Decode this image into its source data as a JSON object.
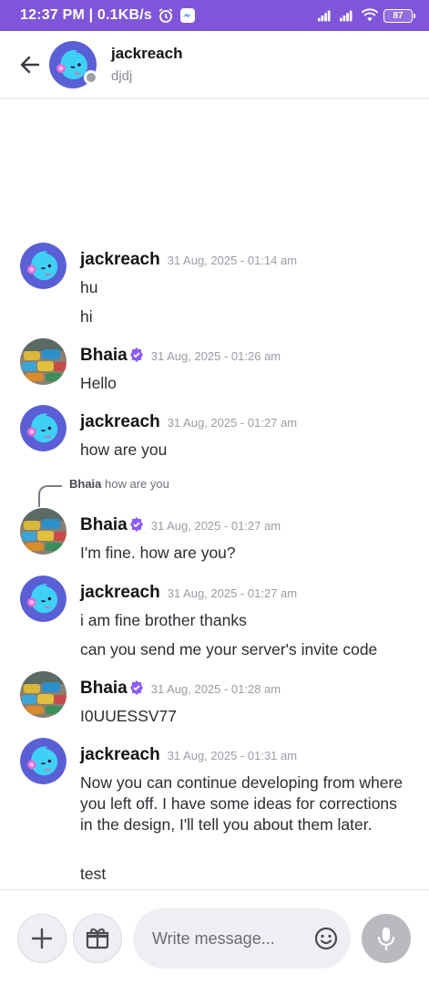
{
  "status_bar": {
    "time": "12:37 PM | 0.1KB/s",
    "battery": "87"
  },
  "header": {
    "name": "jackreach",
    "status": "djdj"
  },
  "reply_hint": {
    "author": "Bhaia",
    "text": "how are you"
  },
  "messages": [
    {
      "author": "jackreach",
      "verified": false,
      "timestamp": "31 Aug, 2025 - 01:14 am",
      "lines": [
        "hu",
        "hi"
      ]
    },
    {
      "author": "Bhaia",
      "verified": true,
      "timestamp": "31 Aug, 2025 - 01:26 am",
      "lines": [
        "Hello"
      ]
    },
    {
      "author": "jackreach",
      "verified": false,
      "timestamp": "31 Aug, 2025 - 01:27 am",
      "lines": [
        "how are you"
      ]
    },
    {
      "author": "Bhaia",
      "verified": true,
      "timestamp": "31 Aug, 2025 - 01:27 am",
      "lines": [
        "I'm fine. how are you?"
      ]
    },
    {
      "author": "jackreach",
      "verified": false,
      "timestamp": "31 Aug, 2025 - 01:27 am",
      "lines": [
        "i am fine brother thanks",
        "can you send me your server's invite code"
      ]
    },
    {
      "author": "Bhaia",
      "verified": true,
      "timestamp": "31 Aug, 2025 - 01:28 am",
      "lines": [
        "I0UUESSV77"
      ]
    },
    {
      "author": "jackreach",
      "verified": false,
      "timestamp": "31 Aug, 2025 - 01:31 am",
      "lines": [
        "Now you can continue developing from where you left off. I have some ideas for corrections in the design, I'll tell you about them later.",
        "test"
      ]
    }
  ],
  "composer": {
    "placeholder": "Write message..."
  },
  "colors": {
    "accent": "#7f56d9",
    "verified_badge": "#8b5cf6",
    "avatar_jackreach_bg": "#5a5fd6"
  }
}
